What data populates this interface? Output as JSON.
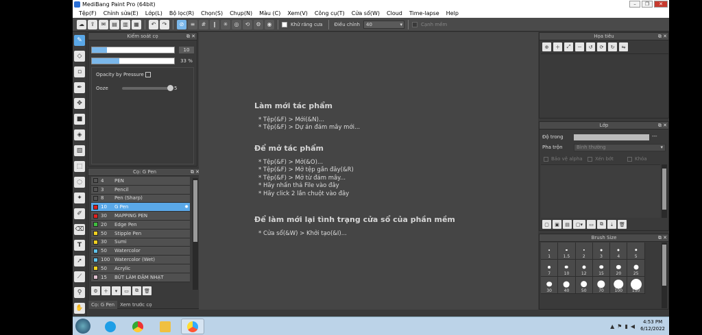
{
  "window": {
    "title": "MediBang Paint Pro (64bit)"
  },
  "menu": [
    "Tệp(F)",
    "Chỉnh sửa(E)",
    "Lớp(L)",
    "Bộ lọc(R)",
    "Chọn(S)",
    "Chụp(N)",
    "Màu (C)",
    "Xem(V)",
    "Công cụ(T)",
    "Cửa sổ(W)",
    "Cloud",
    "Time-lapse",
    "Help"
  ],
  "toolbar": {
    "antialias_label": "Khử răng cưa",
    "adjust_label": "Điều chỉnh",
    "adjust_value": "40",
    "edge_label": "Cạnh mềm"
  },
  "brush_control": {
    "title": "Kiểm soát cọ",
    "size_value": "10",
    "size_level": 0.18,
    "opacity_value": "33 %",
    "opacity_level": 0.33,
    "opacity_pressure_label": "Opacity by Pressure",
    "ooze_label": "Ooze",
    "ooze_value": "5"
  },
  "brush_panel": {
    "title": "Cọ: G Pen",
    "items": [
      {
        "size": "4",
        "name": "PEN",
        "color": "#555555"
      },
      {
        "size": "3",
        "name": "Pencil",
        "color": "#555555"
      },
      {
        "size": "8",
        "name": "Pen (Sharp)",
        "color": "#555555"
      },
      {
        "size": "10",
        "name": "G Pen",
        "color": "#e02020"
      },
      {
        "size": "30",
        "name": "MAPPING PEN",
        "color": "#e02020"
      },
      {
        "size": "20",
        "name": "Edge Pen",
        "color": "#40c040"
      },
      {
        "size": "50",
        "name": "Stipple Pen",
        "color": "#f0d020"
      },
      {
        "size": "30",
        "name": "Sumi",
        "color": "#f0d020"
      },
      {
        "size": "50",
        "name": "Watercolor",
        "color": "#60c0e8"
      },
      {
        "size": "100",
        "name": "Watercolor (Wet)",
        "color": "#60c0e8"
      },
      {
        "size": "50",
        "name": "Acrylic",
        "color": "#f0d020"
      },
      {
        "size": "15",
        "name": "BÚT LÀM ĐẬM NHẠT",
        "color": "#e0c0d0"
      }
    ],
    "tabs": [
      "Cọ: G Pen",
      "Xem trước cọ"
    ]
  },
  "help": {
    "sections": [
      {
        "title": "Làm mới tác phẩm",
        "items": [
          "* Tệp(&F) > Mới(&N)...",
          "* Tệp(&F) > Dự án đám mây mới..."
        ]
      },
      {
        "title": "Để mở tác phẩm",
        "items": [
          "* Tệp(&F) > Mở(&O)...",
          "* Tệp(&F) > Mở tệp gần đây(&R)",
          "* Tệp(&F) > Mở từ đám mây...",
          "* Hãy nhấn thả File vào đây",
          "* Hãy click 2 lần chuột vào đây"
        ]
      },
      {
        "title": "Để làm mới lại tình trạng cửa sổ của phần mềm",
        "items": [
          "* Cửa sổ(&W) > Khởi tạo(&I)..."
        ]
      }
    ]
  },
  "navigator": {
    "title": "Họa tiêu"
  },
  "layer": {
    "title": "Lớp",
    "opacity_label": "Độ trong",
    "opacity_value": "---",
    "blend_label": "Pha trộn",
    "blend_value": "Bình thường",
    "protect_alpha": "Bảo vệ alpha",
    "clipping": "Xén bớt",
    "lock": "Khóa"
  },
  "brush_size": {
    "title": "Brush Size",
    "sizes": [
      "1",
      "1.5",
      "2",
      "3",
      "4",
      "5",
      "7",
      "10",
      "12",
      "15",
      "20",
      "25",
      "30",
      "40",
      "50",
      "70",
      "100",
      "150"
    ]
  },
  "taskbar": {
    "time": "4:53 PM",
    "date": "6/12/2022"
  }
}
